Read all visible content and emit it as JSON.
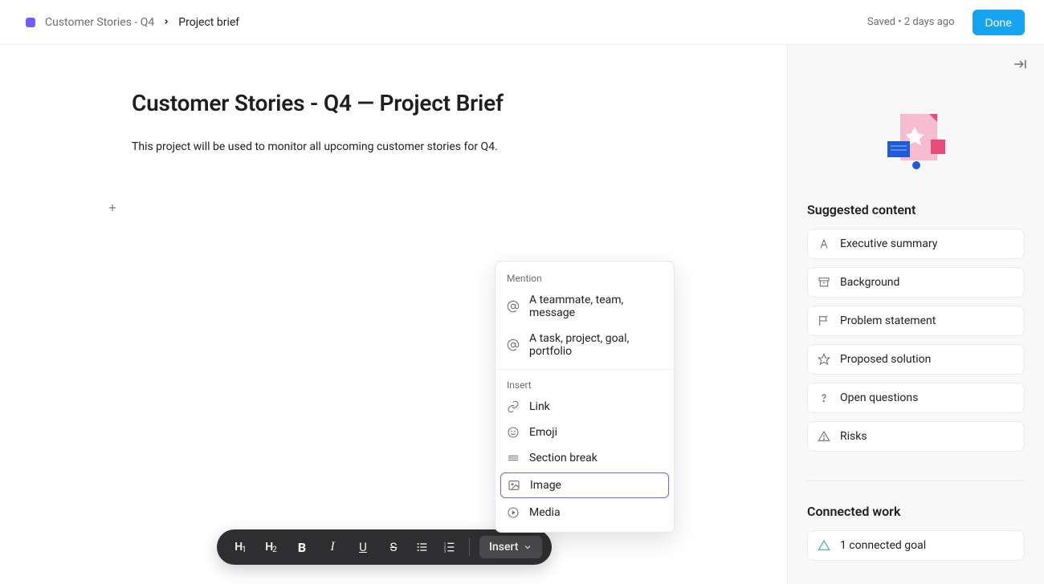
{
  "header": {
    "breadcrumb_root": "Customer Stories - Q4",
    "breadcrumb_current": "Project brief",
    "saved_text": "Saved • 2 days ago",
    "done_label": "Done"
  },
  "document": {
    "title": "Customer Stories - Q4 — Project Brief",
    "body_p1": "This project will be used to monitor all upcoming customer stories for Q4."
  },
  "popup": {
    "section1_title": "Mention",
    "mention1": "A teammate, team, message",
    "mention2": "A task, project, goal, portfolio",
    "section2_title": "Insert",
    "link": "Link",
    "emoji": "Emoji",
    "section_break": "Section break",
    "image": "Image",
    "media": "Media"
  },
  "toolbar": {
    "insert_label": "Insert"
  },
  "sidebar": {
    "suggested_title": "Suggested content",
    "items": [
      {
        "label": "Executive summary"
      },
      {
        "label": "Background"
      },
      {
        "label": "Problem statement"
      },
      {
        "label": "Proposed solution"
      },
      {
        "label": "Open questions"
      },
      {
        "label": "Risks"
      }
    ],
    "connected_title": "Connected work",
    "connected_item": "1 connected goal"
  }
}
